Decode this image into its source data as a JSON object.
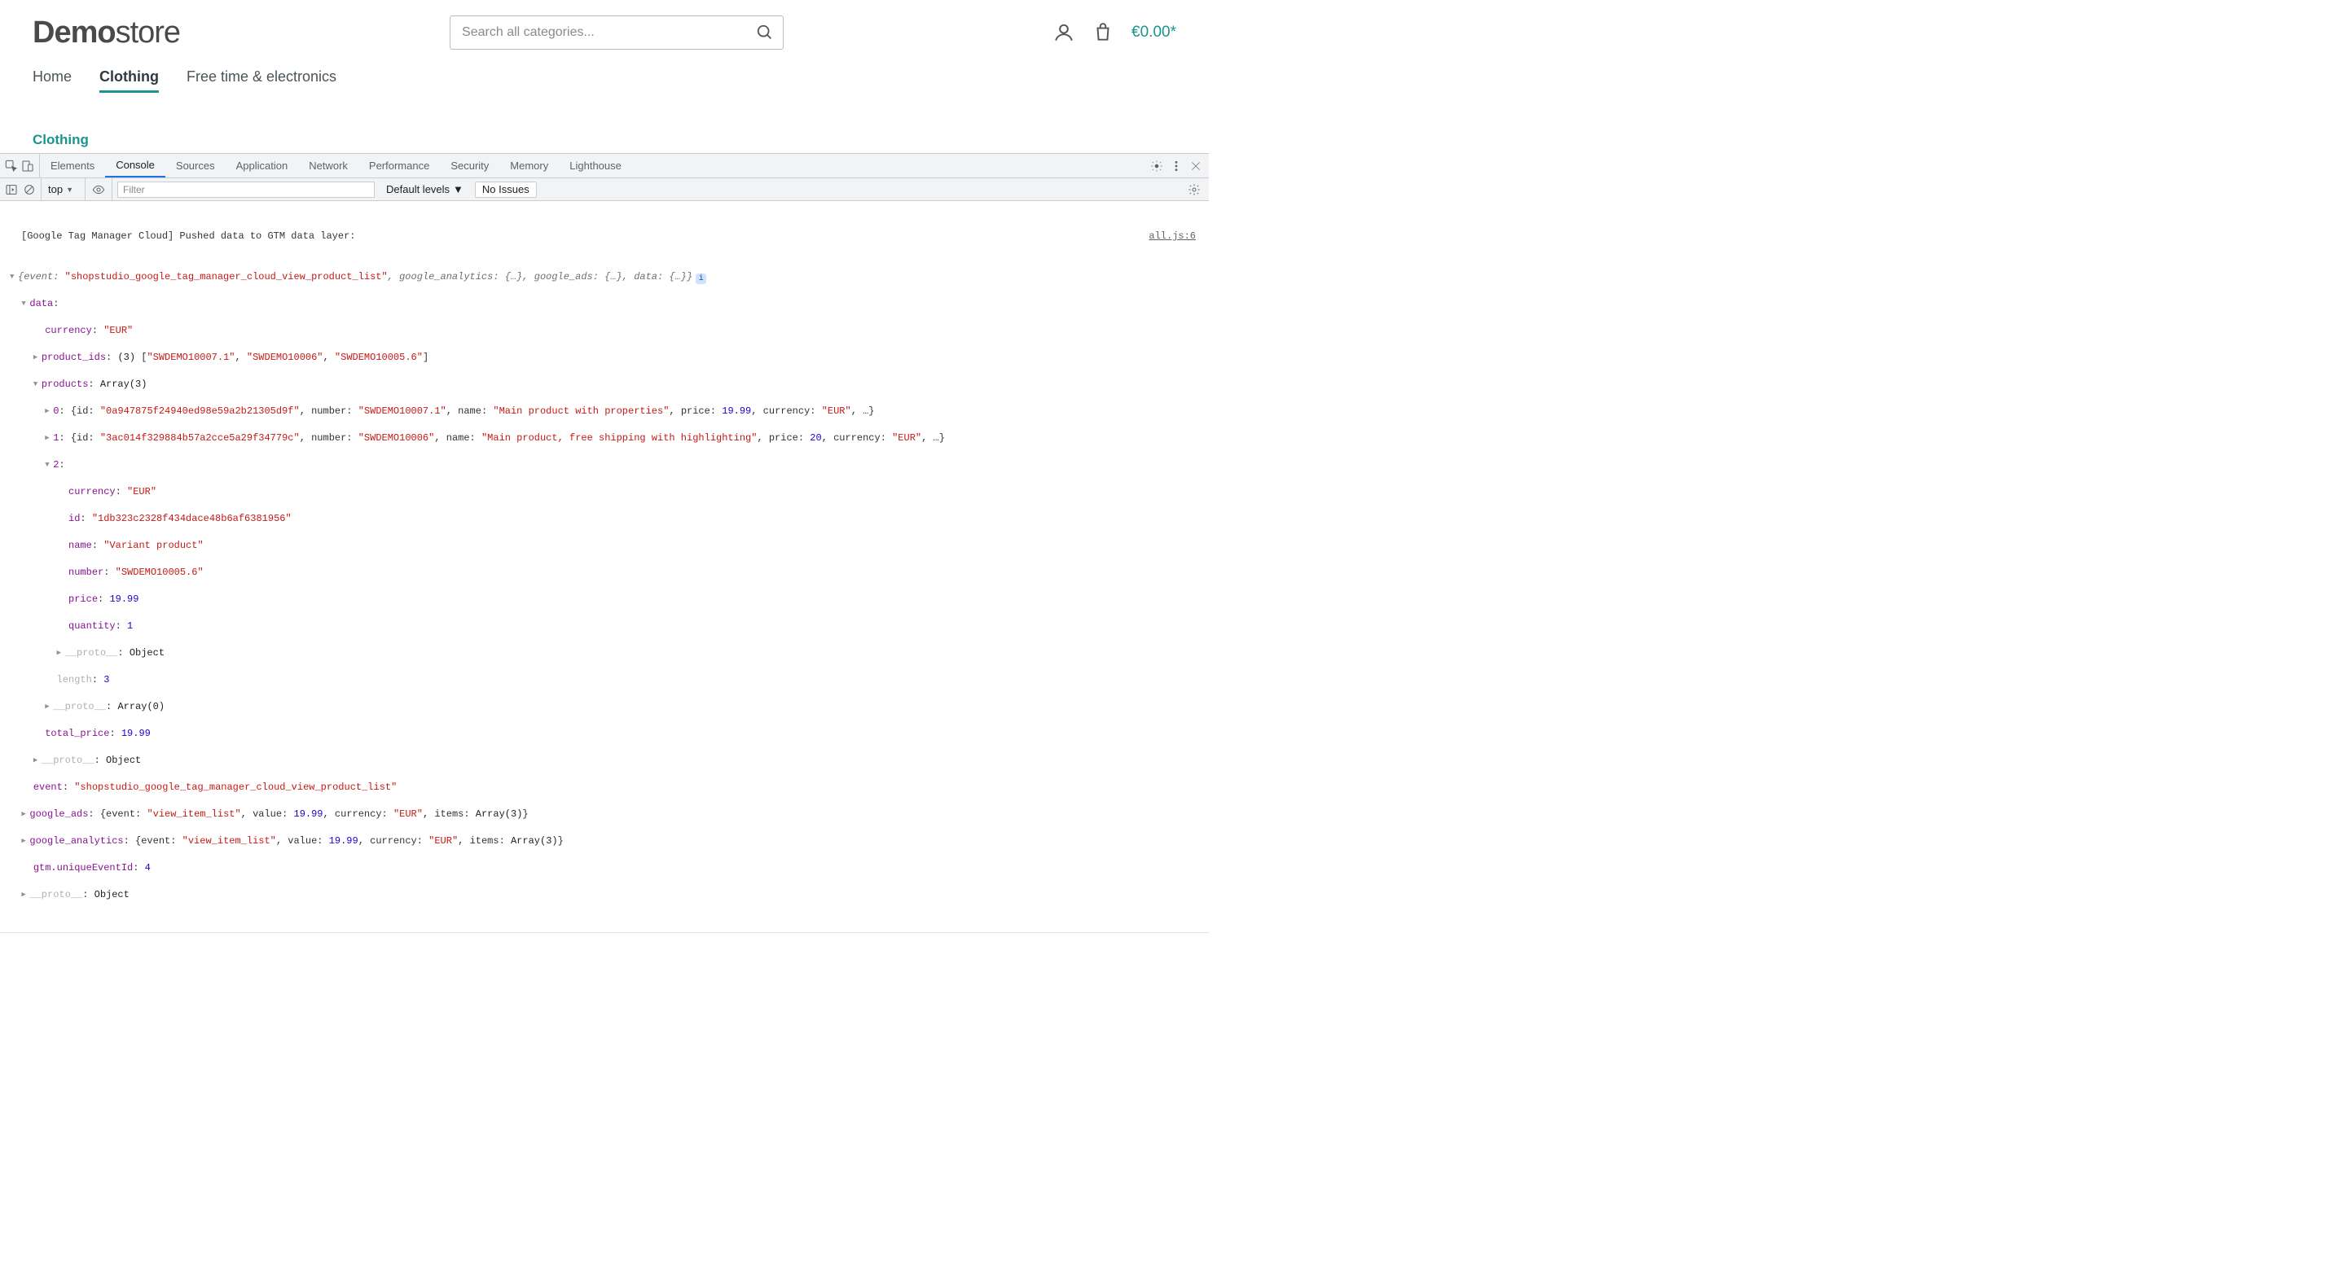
{
  "header": {
    "logo_bold": "Demo",
    "logo_light": "store",
    "search_placeholder": "Search all categories...",
    "cart_total": "€0.00*"
  },
  "nav": {
    "items": [
      "Home",
      "Clothing",
      "Free time & electronics"
    ],
    "active_index": 1
  },
  "breadcrumb": "Clothing",
  "devtools": {
    "tabs": [
      "Elements",
      "Console",
      "Sources",
      "Application",
      "Network",
      "Performance",
      "Security",
      "Memory",
      "Lighthouse"
    ],
    "active_tab_index": 1
  },
  "console_toolbar": {
    "context": "top",
    "filter_placeholder": "Filter",
    "levels_label": "Default levels",
    "issues_label": "No Issues"
  },
  "log": {
    "source_link": "all.js:6",
    "intro": "[Google Tag Manager Cloud] Pushed data to GTM data layer:",
    "summary_event_key": "event:",
    "summary_event_val": "\"shopstudio_google_tag_manager_cloud_view_product_list\"",
    "summary_ga_key": "google_analytics:",
    "summary_ga_val": "{…}",
    "summary_gads_key": "google_ads:",
    "summary_gads_val": "{…}",
    "summary_data_key": "data:",
    "summary_data_val": "{…}",
    "info_badge": "i",
    "data_label": "data",
    "currency_key": "currency",
    "currency_val": "\"EUR\"",
    "product_ids_key": "product_ids",
    "product_ids_count": "(3)",
    "product_ids_vals": [
      "\"SWDEMO10007.1\"",
      "\"SWDEMO10006\"",
      "\"SWDEMO10005.6\""
    ],
    "products_key": "products",
    "products_type": "Array(3)",
    "p0_idx": "0",
    "p0_id": "\"0a947875f24940ed98e59a2b21305d9f\"",
    "p0_number": "\"SWDEMO10007.1\"",
    "p0_name": "\"Main product with properties\"",
    "p0_price": "19.99",
    "p0_currency": "\"EUR\"",
    "p1_idx": "1",
    "p1_id": "\"3ac014f329884b57a2cce5a29f34779c\"",
    "p1_number": "\"SWDEMO10006\"",
    "p1_name": "\"Main product, free shipping with highlighting\"",
    "p1_price": "20",
    "p1_currency": "\"EUR\"",
    "p2_idx": "2",
    "p2_currency_key": "currency",
    "p2_currency_val": "\"EUR\"",
    "p2_id_key": "id",
    "p2_id_val": "\"1db323c2328f434dace48b6af6381956\"",
    "p2_name_key": "name",
    "p2_name_val": "\"Variant product\"",
    "p2_number_key": "number",
    "p2_number_val": "\"SWDEMO10005.6\"",
    "p2_price_key": "price",
    "p2_price_val": "19.99",
    "p2_quantity_key": "quantity",
    "p2_quantity_val": "1",
    "proto_label": "__proto__",
    "proto_obj": "Object",
    "length_key": "length",
    "length_val": "3",
    "proto_arr0": "Array(0)",
    "total_price_key": "total_price",
    "total_price_val": "19.99",
    "event_key": "event",
    "event_val": "\"shopstudio_google_tag_manager_cloud_view_product_list\"",
    "gads_key": "google_ads",
    "gads_event": "\"view_item_list\"",
    "gads_value": "19.99",
    "gads_currency": "\"EUR\"",
    "gads_items": "Array(3)",
    "ga_key": "google_analytics",
    "ga_event": "\"view_item_list\"",
    "ga_value": "19.99",
    "ga_currency": "\"EUR\"",
    "ga_items": "Array(3)",
    "gtm_key": "gtm.uniqueEventId",
    "gtm_val": "4",
    "inline_keys": {
      "id": "id:",
      "number": "number:",
      "name": "name:",
      "price": "price:",
      "currency": "currency:",
      "event": "event:",
      "value": "value:",
      "items": "items:"
    }
  }
}
